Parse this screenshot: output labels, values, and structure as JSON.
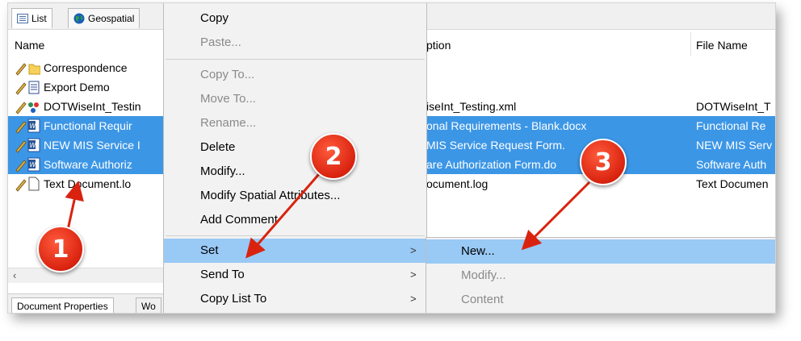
{
  "tabs": [
    {
      "label": "List",
      "icon": "list-icon"
    },
    {
      "label": "Geospatial",
      "icon": "globe-icon"
    }
  ],
  "columns": {
    "name": "Name",
    "description": "ption",
    "file_name": "File Name"
  },
  "rows": [
    {
      "name": "Correspondence",
      "description": "",
      "file": "",
      "icon": "folder-icon",
      "selected": false
    },
    {
      "name": "Export Demo",
      "description": "",
      "file": "",
      "icon": "document-icon",
      "selected": false
    },
    {
      "name": "DOTWiseInt_Testin",
      "description": "iseInt_Testing.xml",
      "file": "DOTWiseInt_T",
      "icon": "xml-icon",
      "selected": false
    },
    {
      "name": "Functional Requir",
      "description": "onal Requirements - Blank.docx",
      "file": "Functional Re",
      "icon": "word-icon",
      "selected": true
    },
    {
      "name": "NEW MIS Service I",
      "description": "MIS Service Request Form.",
      "file": "NEW MIS Serv",
      "icon": "word-icon",
      "selected": true
    },
    {
      "name": "Software Authoriz",
      "description": "are Authorization Form.do",
      "file": "Software Auth",
      "icon": "word-icon",
      "selected": true
    },
    {
      "name": "Text Document.lo",
      "description": "ocument.log",
      "file": "Text Documen",
      "icon": "text-file-icon",
      "selected": false
    }
  ],
  "bottom_tabs": {
    "document_properties": "Document Properties",
    "second": "Wo"
  },
  "menu": {
    "copy": "Copy",
    "paste": "Paste...",
    "copy_to": "Copy To...",
    "move_to": "Move To...",
    "rename": "Rename...",
    "delete": "Delete",
    "modify": "Modify...",
    "modify_spatial": "Modify Spatial Attributes...",
    "add_comment": "Add Comment",
    "set": "Set",
    "send_to": "Send To",
    "copy_list_to": "Copy List To",
    "arrow": ">"
  },
  "submenu": {
    "new": "New...",
    "modify": "Modify...",
    "content": "Content"
  },
  "badges": {
    "one": "1",
    "two": "2",
    "three": "3"
  },
  "colors": {
    "selection": "#3c96e6",
    "menu_highlight": "#99c9f5",
    "badge": "#d9230f"
  }
}
